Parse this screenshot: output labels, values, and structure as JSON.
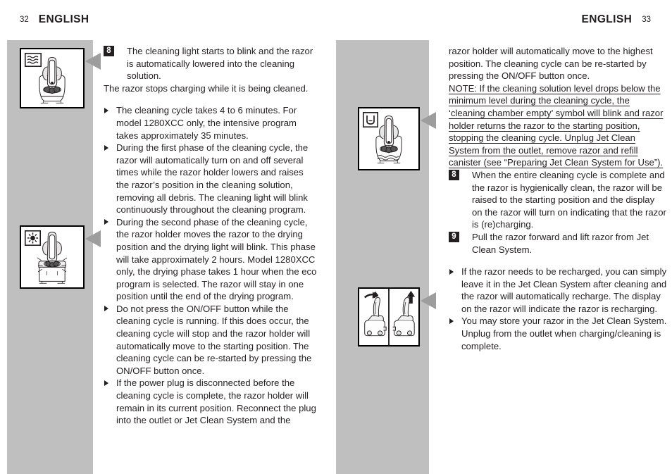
{
  "headers": {
    "left": {
      "folio": "32",
      "title": "ENGLISH"
    },
    "right": {
      "title": "ENGLISH",
      "folio": "33"
    }
  },
  "colors": {
    "grey_band": "#bfbfbf",
    "text": "#231f20",
    "step_badge_bg": "#231f20",
    "step_badge_text": "#ffffff",
    "pointer": "#9d9d9d"
  },
  "figures": [
    {
      "id": "fig-cleaning",
      "icon_name": "water-waves-icon",
      "caption": "Razor lowered into cleaning solution, water symbol"
    },
    {
      "id": "fig-drying",
      "icon_name": "sun-drying-icon",
      "caption": "Razor in drying position, drying symbol"
    },
    {
      "id": "fig-empty",
      "icon_name": "cleaning-chamber-empty-icon",
      "caption": "Cleaning chamber empty symbol, low solution level"
    },
    {
      "id": "fig-remove",
      "icon_name": "pull-and-lift-razor-icon",
      "caption": "Pull razor forward and lift razor out"
    }
  ],
  "left_column": {
    "step8": {
      "number": "8",
      "text": "The cleaning light starts to blink and the razor is automatically lowered into the cleaning solution."
    },
    "step8_followup": "The razor stops charging while it is being cleaned.",
    "bullets": [
      "The cleaning cycle takes 4 to 6 minutes. For model 1280XCC only, the intensive program takes approximately 35 minutes.",
      "During the first phase of the cleaning cycle, the razor will automatically turn on and off several times while the razor holder lowers and raises the razor’s position in the cleaning solution, removing all debris. The cleaning light will blink continuously throughout the cleaning program.",
      "During the second phase of the cleaning cycle, the razor holder moves the razor to the drying position and the drying light will blink. This phase will take approximately 2 hours. Model 1280XCC only, the drying phase takes 1 hour when the eco program is selected. The razor will stay in one position until the end of the drying program.",
      "Do not press the ON/OFF button while the cleaning cycle is running.  If this does occur, the cleaning cycle will stop and the razor holder will automatically move to the starting position. The cleaning cycle can be re-started by pressing the ON/OFF button once.",
      "If the power plug is disconnected before the cleaning cycle is complete, the razor holder will remain in its current position.  Reconnect the plug into the outlet or Jet Clean System and the"
    ]
  },
  "right_column": {
    "continuation": "razor holder will automatically move to the highest position.  The cleaning cycle can be re-started by pressing the ON/OFF button once.",
    "note": "NOTE: If the cleaning solution level drops below the minimum level during the cleaning cycle, the ‘cleaning chamber empty’ symbol will blink and razor holder returns the razor to the starting position, stopping the cleaning cycle. Unplug Jet Clean System from the outlet, remove razor and refill canister (see “Preparing Jet Clean System for Use”).",
    "step8": {
      "number": "8",
      "text": "When the entire cleaning cycle is complete and the razor is hygienically clean, the razor will be raised to the starting position and the display on the razor will turn on indicating that the razor is (re)charging."
    },
    "step9": {
      "number": "9",
      "text": "Pull the razor forward and lift razor from Jet Clean System."
    },
    "bullets": [
      "If the razor needs to be recharged, you can simply leave it in the Jet Clean System after cleaning and the razor will automatically recharge. The display on the razor will indicate the razor is recharging.",
      "You may store your razor in the Jet Clean System. Unplug from the outlet when charging/cleaning is complete."
    ]
  }
}
